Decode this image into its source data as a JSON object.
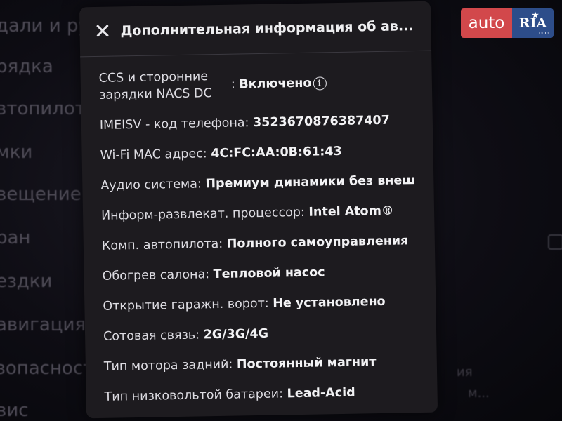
{
  "background_menu": [
    "дали и ру",
    "рядка",
    "втопилот",
    "мки",
    "вещение",
    "ран",
    "ездки",
    "авигация",
    "зопасност",
    "вис"
  ],
  "background_right": [
    "ия",
    "м..."
  ],
  "dialog": {
    "title": "Дополнительная информация об ав...",
    "rows": [
      {
        "label": "CCS и сторонние зарядки NACS DC",
        "sep": ":",
        "value": "Включено",
        "info_icon": "i"
      },
      {
        "label": "IMEISV - код телефона",
        "sep": ":",
        "value": "3523670876387407"
      },
      {
        "label": "Wi-Fi MAC адрес",
        "sep": ":",
        "value": "4C:FC:AA:0B:61:43"
      },
      {
        "label": "Аудио система",
        "sep": ":",
        "value": "Премиум динамики без внеш"
      },
      {
        "label": "Информ-развлекат. процессор",
        "sep": ":",
        "value": "Intel Atom®"
      },
      {
        "label": "Комп. автопилота",
        "sep": ":",
        "value": "Полного самоуправления"
      },
      {
        "label": "Обогрев салона",
        "sep": ":",
        "value": "Тепловой насос"
      },
      {
        "label": "Открытие гаражн. ворот",
        "sep": ":",
        "value": "Не установлено"
      },
      {
        "label": "Сотовая связь",
        "sep": ":",
        "value": "2G/3G/4G"
      },
      {
        "label": "Тип мотора задний",
        "sep": ":",
        "value": "Постоянный магнит"
      },
      {
        "label": "Тип низковольтой батареи",
        "sep": ":",
        "value": "Lead-Acid"
      }
    ]
  },
  "logo": {
    "auto": "auto",
    "ria": "RIA",
    "com": ".com"
  },
  "colors": {
    "logo_red": "#d2484b",
    "logo_blue": "#2d4d8a",
    "dialog_bg": "#1d1b1f"
  },
  "icons": {
    "close": "close-icon",
    "info": "info-icon"
  }
}
